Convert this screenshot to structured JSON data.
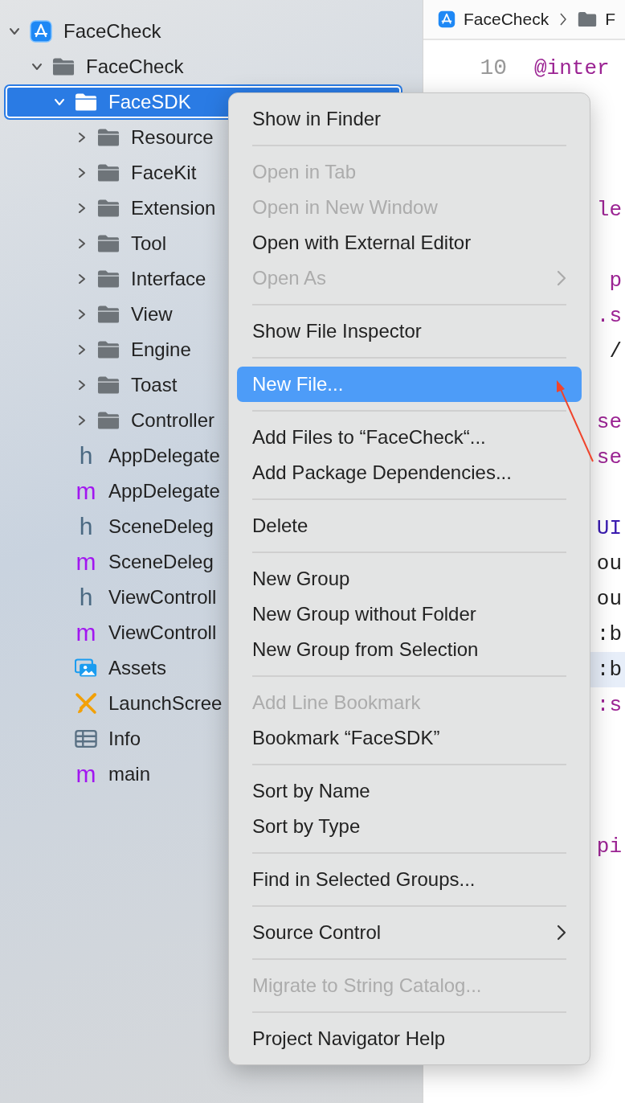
{
  "navigator": {
    "tree": [
      {
        "label": "FaceCheck",
        "kind": "project",
        "expanded": true,
        "selected": false,
        "children": [
          {
            "label": "FaceCheck",
            "kind": "folder",
            "expanded": true,
            "selected": false,
            "children": [
              {
                "label": "FaceSDK",
                "kind": "folder",
                "expanded": true,
                "selected": true,
                "children": [
                  {
                    "label": "Resource",
                    "kind": "folder",
                    "expanded": false,
                    "selected": false
                  },
                  {
                    "label": "FaceKit",
                    "kind": "folder",
                    "expanded": false,
                    "selected": false
                  },
                  {
                    "label": "Extension",
                    "kind": "folder",
                    "expanded": false,
                    "selected": false
                  },
                  {
                    "label": "Tool",
                    "kind": "folder",
                    "expanded": false,
                    "selected": false
                  },
                  {
                    "label": "Interface",
                    "kind": "folder",
                    "expanded": false,
                    "selected": false
                  },
                  {
                    "label": "View",
                    "kind": "folder",
                    "expanded": false,
                    "selected": false
                  },
                  {
                    "label": "Engine",
                    "kind": "folder",
                    "expanded": false,
                    "selected": false
                  },
                  {
                    "label": "Toast",
                    "kind": "folder",
                    "expanded": false,
                    "selected": false
                  },
                  {
                    "label": "Controller",
                    "kind": "folder",
                    "expanded": false,
                    "selected": false
                  }
                ]
              },
              {
                "label": "AppDelegate",
                "kind": "header",
                "icon_char": "h",
                "selected": false
              },
              {
                "label": "AppDelegate",
                "kind": "source",
                "icon_char": "m",
                "selected": false
              },
              {
                "label": "SceneDeleg",
                "kind": "header",
                "icon_char": "h",
                "selected": false
              },
              {
                "label": "SceneDeleg",
                "kind": "source",
                "icon_char": "m",
                "selected": false
              },
              {
                "label": "ViewControll",
                "kind": "header",
                "icon_char": "h",
                "selected": false
              },
              {
                "label": "ViewControll",
                "kind": "source",
                "icon_char": "m",
                "selected": false
              },
              {
                "label": "Assets",
                "kind": "assets",
                "selected": false
              },
              {
                "label": "LaunchScree",
                "kind": "storyboard",
                "selected": false
              },
              {
                "label": "Info",
                "kind": "plist",
                "selected": false
              },
              {
                "label": "main",
                "kind": "source",
                "icon_char": "m",
                "selected": false
              }
            ]
          }
        ]
      }
    ]
  },
  "editor": {
    "breadcrumb": [
      {
        "kind": "project",
        "label": "FaceCheck"
      },
      {
        "kind": "folder",
        "label": "F"
      }
    ],
    "line_number": "10",
    "lines": [
      {
        "text": "@inter",
        "kind": "keyword",
        "highlighted": false
      },
      {
        "kind": "blank"
      },
      {
        "kind": "blank"
      },
      {
        "kind": "blank"
      },
      {
        "text": "le",
        "kind": "keyword",
        "highlighted": false
      },
      {
        "kind": "blank"
      },
      {
        "text": "p",
        "kind": "keyword",
        "highlighted": false
      },
      {
        "text": ".s",
        "kind": "keyword",
        "highlighted": false
      },
      {
        "text": "/",
        "kind": "plain",
        "highlighted": false
      },
      {
        "kind": "blank"
      },
      {
        "text": "se",
        "kind": "keyword",
        "highlighted": false
      },
      {
        "text": "se",
        "kind": "keyword",
        "highlighted": false
      },
      {
        "kind": "blank"
      },
      {
        "text": "UI",
        "kind": "type",
        "highlighted": false
      },
      {
        "text": "ou",
        "kind": "plain",
        "highlighted": false
      },
      {
        "text": "ou",
        "kind": "plain",
        "highlighted": false
      },
      {
        "text": ":b",
        "kind": "plain",
        "highlighted": false
      },
      {
        "text": ":b",
        "kind": "plain",
        "highlighted": true
      },
      {
        "text": ":s",
        "kind": "keyword",
        "highlighted": false
      },
      {
        "kind": "blank"
      },
      {
        "kind": "blank"
      },
      {
        "kind": "blank"
      },
      {
        "text": "pi",
        "kind": "keyword",
        "highlighted": false
      }
    ]
  },
  "context_menu": {
    "items": [
      {
        "kind": "item",
        "label": "Show in Finder",
        "disabled": false,
        "selected": false,
        "submenu": false
      },
      {
        "kind": "separator"
      },
      {
        "kind": "item",
        "label": "Open in Tab",
        "disabled": true,
        "selected": false,
        "submenu": false
      },
      {
        "kind": "item",
        "label": "Open in New Window",
        "disabled": true,
        "selected": false,
        "submenu": false
      },
      {
        "kind": "item",
        "label": "Open with External Editor",
        "disabled": false,
        "selected": false,
        "submenu": false
      },
      {
        "kind": "item",
        "label": "Open As",
        "disabled": true,
        "selected": false,
        "submenu": true
      },
      {
        "kind": "separator"
      },
      {
        "kind": "item",
        "label": "Show File Inspector",
        "disabled": false,
        "selected": false,
        "submenu": false
      },
      {
        "kind": "separator"
      },
      {
        "kind": "item",
        "label": "New File...",
        "disabled": false,
        "selected": true,
        "submenu": false
      },
      {
        "kind": "separator"
      },
      {
        "kind": "item",
        "label": "Add Files to “FaceCheck“...",
        "disabled": false,
        "selected": false,
        "submenu": false
      },
      {
        "kind": "item",
        "label": "Add Package Dependencies...",
        "disabled": false,
        "selected": false,
        "submenu": false
      },
      {
        "kind": "separator"
      },
      {
        "kind": "item",
        "label": "Delete",
        "disabled": false,
        "selected": false,
        "submenu": false
      },
      {
        "kind": "separator"
      },
      {
        "kind": "item",
        "label": "New Group",
        "disabled": false,
        "selected": false,
        "submenu": false
      },
      {
        "kind": "item",
        "label": "New Group without Folder",
        "disabled": false,
        "selected": false,
        "submenu": false
      },
      {
        "kind": "item",
        "label": "New Group from Selection",
        "disabled": false,
        "selected": false,
        "submenu": false
      },
      {
        "kind": "separator"
      },
      {
        "kind": "item",
        "label": "Add Line Bookmark",
        "disabled": true,
        "selected": false,
        "submenu": false
      },
      {
        "kind": "item",
        "label": "Bookmark “FaceSDK”",
        "disabled": false,
        "selected": false,
        "submenu": false
      },
      {
        "kind": "separator"
      },
      {
        "kind": "item",
        "label": "Sort by Name",
        "disabled": false,
        "selected": false,
        "submenu": false
      },
      {
        "kind": "item",
        "label": "Sort by Type",
        "disabled": false,
        "selected": false,
        "submenu": false
      },
      {
        "kind": "separator"
      },
      {
        "kind": "item",
        "label": "Find in Selected Groups...",
        "disabled": false,
        "selected": false,
        "submenu": false
      },
      {
        "kind": "separator"
      },
      {
        "kind": "item",
        "label": "Source Control",
        "disabled": false,
        "selected": false,
        "submenu": true
      },
      {
        "kind": "separator"
      },
      {
        "kind": "item",
        "label": "Migrate to String Catalog...",
        "disabled": true,
        "selected": false,
        "submenu": false
      },
      {
        "kind": "separator"
      },
      {
        "kind": "item",
        "label": "Project Navigator Help",
        "disabled": false,
        "selected": false,
        "submenu": false
      }
    ]
  }
}
